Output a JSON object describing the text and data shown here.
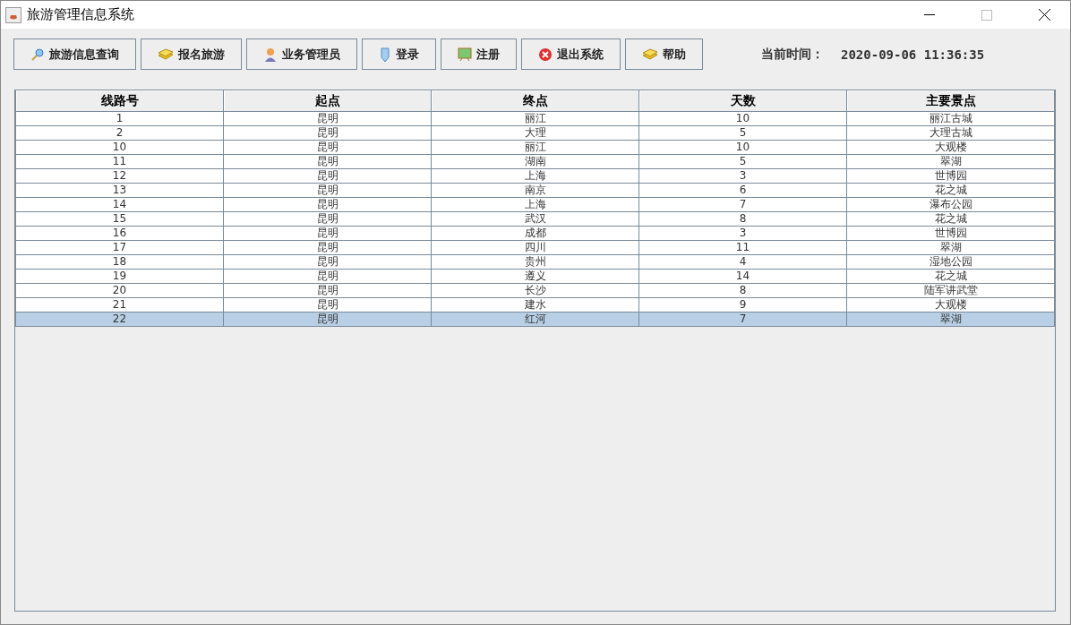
{
  "window": {
    "title": "旅游管理信息系统"
  },
  "toolbar": [
    {
      "label": "旅游信息查询"
    },
    {
      "label": "报名旅游"
    },
    {
      "label": "业务管理员"
    },
    {
      "label": "登录"
    },
    {
      "label": "注册"
    },
    {
      "label": "退出系统"
    },
    {
      "label": "帮助"
    }
  ],
  "clock": {
    "label": "当前时间：",
    "value": "2020-09-06 11:36:35"
  },
  "table": {
    "columns": [
      "线路号",
      "起点",
      "终点",
      "天数",
      "主要景点"
    ],
    "rows": [
      {
        "cells": [
          "1",
          "昆明",
          "丽江",
          "10",
          "丽江古城"
        ],
        "selected": false
      },
      {
        "cells": [
          "2",
          "昆明",
          "大理",
          "5",
          "大理古城"
        ],
        "selected": false
      },
      {
        "cells": [
          "10",
          "昆明",
          "丽江",
          "10",
          "大观楼"
        ],
        "selected": false
      },
      {
        "cells": [
          "11",
          "昆明",
          "湖南",
          "5",
          "翠湖"
        ],
        "selected": false
      },
      {
        "cells": [
          "12",
          "昆明",
          "上海",
          "3",
          "世博园"
        ],
        "selected": false
      },
      {
        "cells": [
          "13",
          "昆明",
          "南京",
          "6",
          "花之城"
        ],
        "selected": false
      },
      {
        "cells": [
          "14",
          "昆明",
          "上海",
          "7",
          "瀑布公园"
        ],
        "selected": false
      },
      {
        "cells": [
          "15",
          "昆明",
          "武汉",
          "8",
          "花之城"
        ],
        "selected": false
      },
      {
        "cells": [
          "16",
          "昆明",
          "成都",
          "3",
          "世博园"
        ],
        "selected": false
      },
      {
        "cells": [
          "17",
          "昆明",
          "四川",
          "11",
          "翠湖"
        ],
        "selected": false
      },
      {
        "cells": [
          "18",
          "昆明",
          "贵州",
          "4",
          "湿地公园"
        ],
        "selected": false
      },
      {
        "cells": [
          "19",
          "昆明",
          "遵义",
          "14",
          "花之城"
        ],
        "selected": false
      },
      {
        "cells": [
          "20",
          "昆明",
          "长沙",
          "8",
          "陆军讲武堂"
        ],
        "selected": false
      },
      {
        "cells": [
          "21",
          "昆明",
          "建水",
          "9",
          "大观楼"
        ],
        "selected": false
      },
      {
        "cells": [
          "22",
          "昆明",
          "红河",
          "7",
          "翠湖"
        ],
        "selected": true
      }
    ]
  }
}
